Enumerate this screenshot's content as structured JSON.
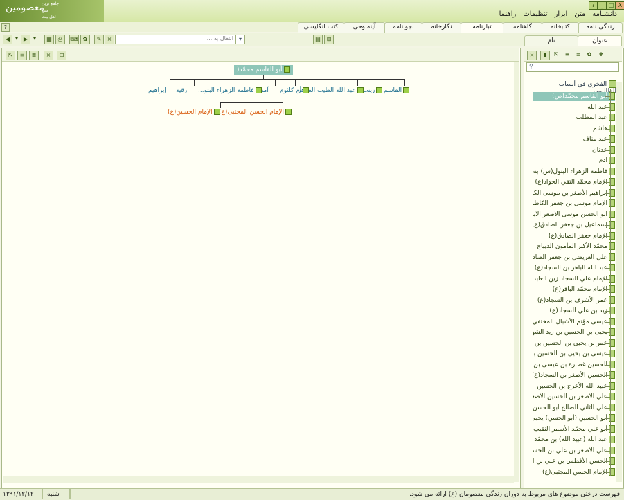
{
  "app": {
    "logo_line1": "معصومين",
    "logo_line2": "جامع ترين",
    "logo_line3": "منبع",
    "logo_line4": "اهل بيت",
    "window_buttons": [
      "?",
      "_",
      "□",
      "X"
    ]
  },
  "menu": [
    "دانشنامه",
    "متن",
    "ابزار",
    "تنظيمات",
    "راهنما"
  ],
  "tabs": [
    "زندگی نامه",
    "کتابخانه",
    "گاهنامه",
    "تبارنامه",
    "نگارخانه",
    "نجوانامه",
    "آینه وحی",
    "کتب انگلیسی"
  ],
  "active_tab": "تبارنامه",
  "toolbar": {
    "search_placeholder": "انتقال به ..."
  },
  "subtabs": {
    "title": "عنوان",
    "name": "نام"
  },
  "tree": {
    "root": "أبو القاسم محمّد(",
    "level1": [
      "القاسم",
      "زينب",
      "عبد الله الطيب الطاهر",
      "أم كلثوم",
      "آمنة",
      "فاطمة الزهراء البتو...",
      "رقية",
      "إبراهيم"
    ],
    "level2": [
      "الإمام الحسن المجتبی(ع)",
      "الإمام الحسین(ع)"
    ]
  },
  "right_tree": {
    "root": "الفخري في أنساب الطالبيين",
    "items": [
      "أبو القاسم محمّد(ص)",
      "عبد الله",
      "عبد المطلب",
      "هاشم",
      "عبد مناف",
      "عدنان",
      "آدم",
      "فاطمة الزهراء البتول(س) بنت",
      "الإمام محمّد التقي الجواد(ع)",
      "إبراهيم الأصغر بن موسى الكا",
      "الإمام موسى بن جعفر الكاظم",
      "أبو الحسن موسى الأصغر الأبرش",
      "إسماعيل بن جعفر الصادق(ع)",
      "الإمام جعفر الصادق(ع)",
      "محمّد الأكبر المأمون الديباج",
      "علي العريضي بن جعفر الصادق",
      "عبد الله الباهر بن السجاد(ع)",
      "الإمام علي السجاد زين العابدين",
      "الإمام محمّد الباقر(ع)",
      "عمر الأشرف بن السجاد(ع)",
      "زيد بن علي السجاد(ع)",
      "عيسى مؤتم الأشبال المختفي",
      "يحيى بن الحسين بن زيد الشهيد",
      "عمر بن يحيى بن الحسين بن زيد",
      "عيسى بن يحيى بن الحسين بن",
      "الحسين غضارة بن عيسى بن يحيى",
      "الحسين الأصغر بن السجاد(ع)",
      "عبيد الله الأعرج بن الحسين",
      "علي الأصغر بن الحسين الأصغر",
      "علي الثاني الصالح أبو الحسن",
      "أبو الحسين (أبو الحسن) يحيى",
      "أبو علي محمّد الأسمر النقيب",
      "عبد الله (عبيد الله) بن محمّد",
      "علي الأصغر بن علي بن الحسن",
      "الحسن الأفطس بن علي بن الحسن",
      "الإمام الحسن المجتبی(ع)"
    ]
  },
  "status": {
    "message": "فهرست درختی موضوع های مربوط به دوران زندگی معصومان (ع) ارائه می شود.",
    "day": "شنبه",
    "date": "۱۳۹۱/۱۲/۱۲"
  },
  "colors": {
    "accent": "#8fc6b8",
    "node_text": "#1e6f8f",
    "node_orange": "#d95d10",
    "tree_icon": "#9ed04a"
  }
}
